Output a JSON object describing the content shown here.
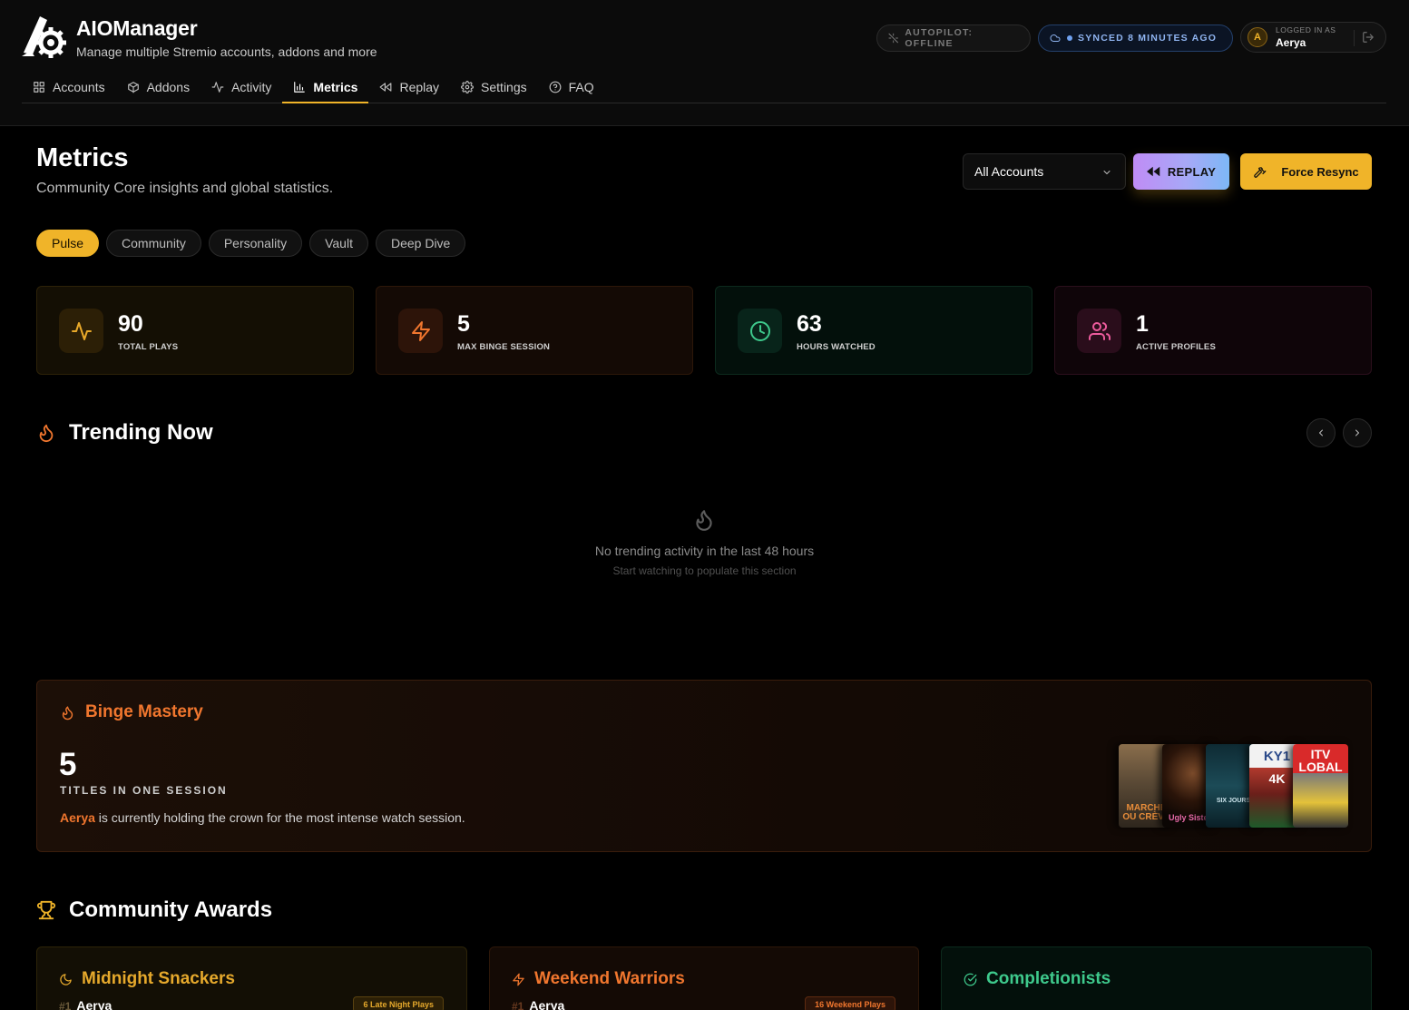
{
  "app": {
    "title": "AIOManager",
    "subtitle": "Manage multiple Stremio accounts, addons and more"
  },
  "nav": {
    "items": [
      {
        "label": "Accounts",
        "icon": "grid-icon"
      },
      {
        "label": "Addons",
        "icon": "package-icon"
      },
      {
        "label": "Activity",
        "icon": "activity-icon"
      },
      {
        "label": "Metrics",
        "icon": "bar-chart-icon",
        "active": true
      },
      {
        "label": "Replay",
        "icon": "rewind-icon"
      },
      {
        "label": "Settings",
        "icon": "gear-icon"
      },
      {
        "label": "FAQ",
        "icon": "help-circle-icon"
      }
    ]
  },
  "status": {
    "autopilot": "AUTOPILOT: OFFLINE",
    "sync": "SYNCED 8 MINUTES AGO"
  },
  "user": {
    "initial": "A",
    "label": "LOGGED IN AS",
    "name": "Aerya"
  },
  "page": {
    "title": "Metrics",
    "subtitle": "Community Core insights and global statistics."
  },
  "controls": {
    "account_select": "All Accounts",
    "replay_label": "REPLAY",
    "resync_label": "Force Resync"
  },
  "tabs": [
    {
      "label": "Pulse",
      "active": true
    },
    {
      "label": "Community"
    },
    {
      "label": "Personality"
    },
    {
      "label": "Vault"
    },
    {
      "label": "Deep Dive"
    }
  ],
  "stats": [
    {
      "value": "90",
      "label": "TOTAL PLAYS",
      "icon": "activity-icon",
      "color": "#e9a92a"
    },
    {
      "value": "5",
      "label": "MAX BINGE SESSION",
      "icon": "zap-icon",
      "color": "#f0762e"
    },
    {
      "value": "63",
      "label": "HOURS WATCHED",
      "icon": "clock-icon",
      "color": "#3ec98c"
    },
    {
      "value": "1",
      "label": "ACTIVE PROFILES",
      "icon": "users-icon",
      "color": "#ec5b9c"
    }
  ],
  "trending": {
    "title": "Trending Now",
    "empty_title": "No trending activity in the last 48 hours",
    "empty_sub": "Start watching to populate this section"
  },
  "binge": {
    "title": "Binge Mastery",
    "value": "5",
    "label": "TITLES IN ONE SESSION",
    "holder": "Aerya",
    "desc": " is currently holding the crown for the most intense watch session.",
    "posters": [
      {
        "text": "MARCHE OU CRÈVE"
      },
      {
        "text": "Ugly Sister"
      },
      {
        "text": "SIX JOURS"
      },
      {
        "text": "KY1",
        "text2": "4K"
      },
      {
        "text": "ITV LOBAL"
      }
    ]
  },
  "awards": {
    "title": "Community Awards",
    "items": [
      {
        "title": "Midnight Snackers",
        "icon": "moon-icon",
        "rank": "#1",
        "name": "Aerya",
        "badge": "6 Late Night Plays"
      },
      {
        "title": "Weekend Warriors",
        "icon": "zap-icon",
        "rank": "#1",
        "name": "Aerya",
        "badge": "16 Weekend Plays"
      },
      {
        "title": "Completionists",
        "icon": "check-circle-icon"
      }
    ]
  },
  "colors": {
    "accent": "#f0b429",
    "orange": "#f0762e",
    "green": "#3ec98c",
    "pink": "#ec5b9c"
  }
}
